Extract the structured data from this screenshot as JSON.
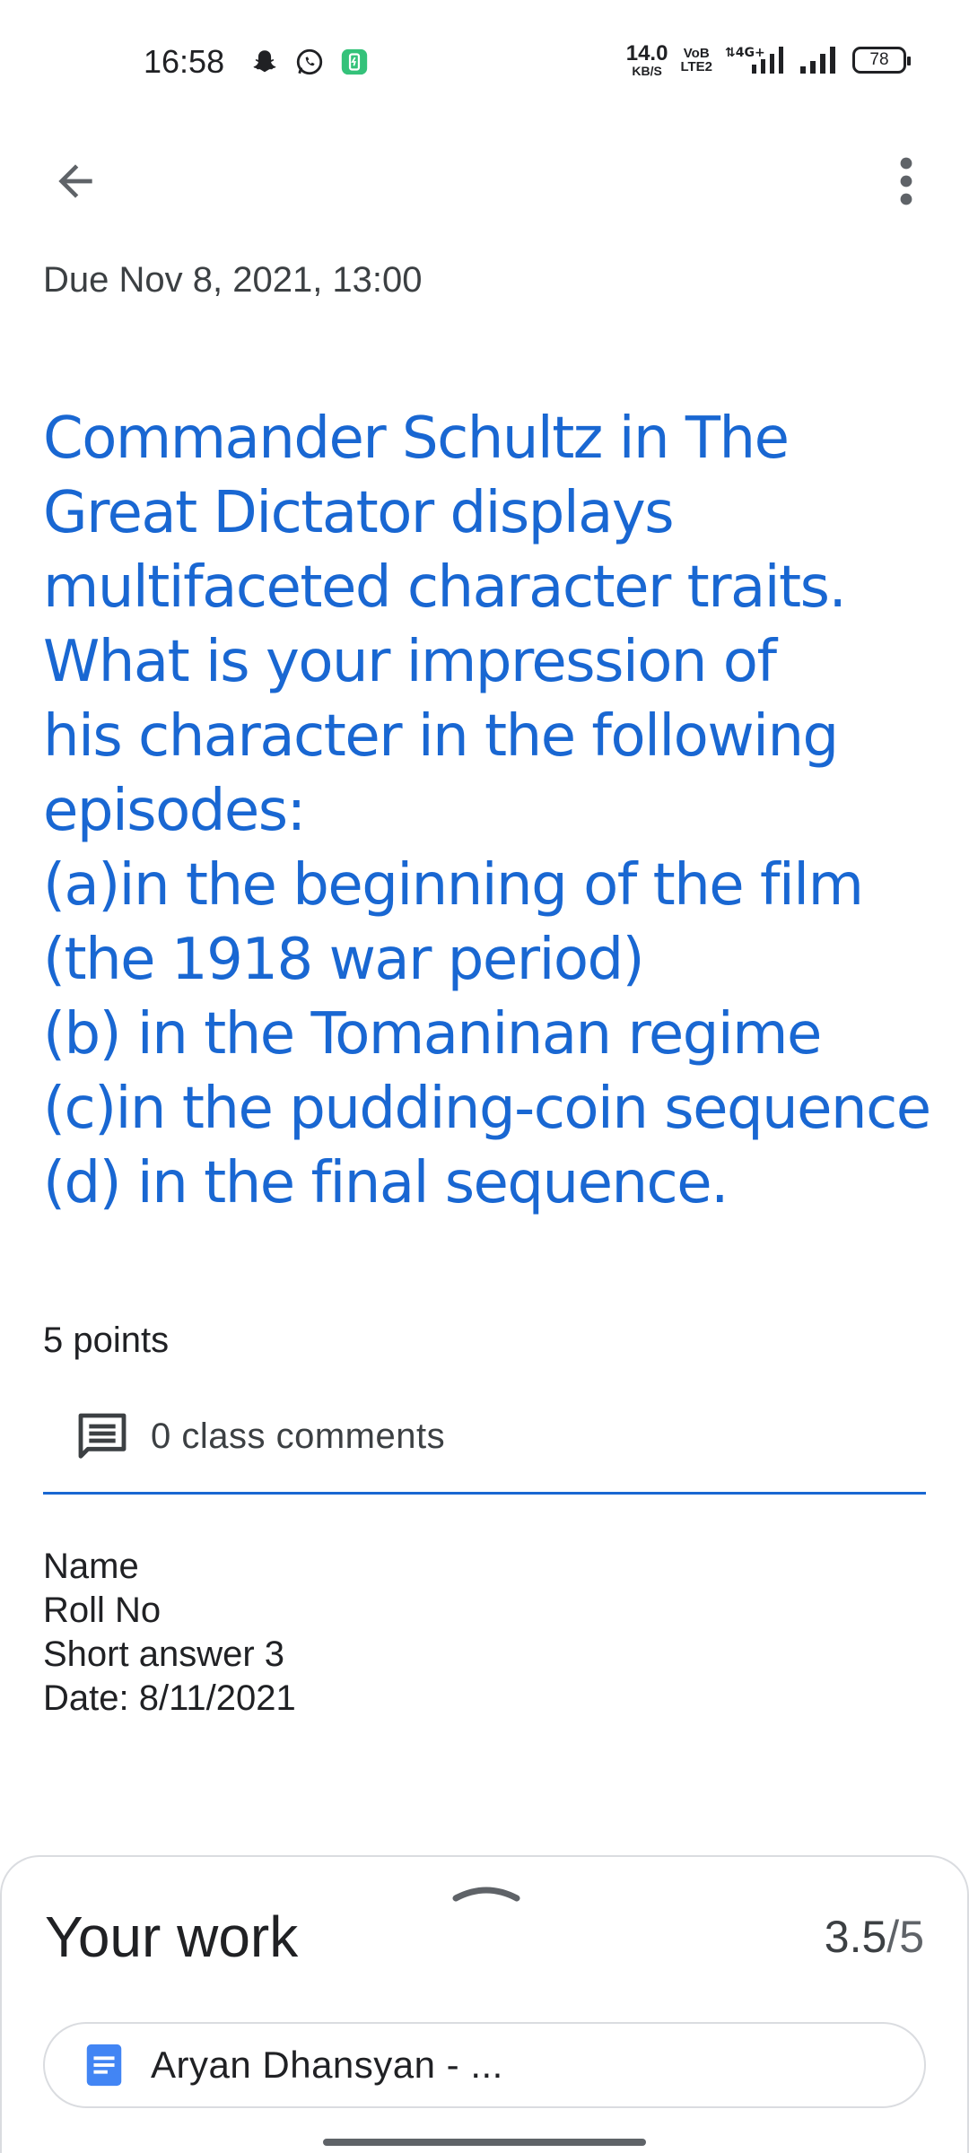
{
  "status_bar": {
    "time": "16:58",
    "net_speed": "14.0",
    "net_unit": "KB/S",
    "volte_top": "VoB",
    "volte_bottom": "LTE2",
    "network": "4G+",
    "battery": "78"
  },
  "icons": {
    "back": "arrow-left-icon",
    "more": "more-vert-icon",
    "comments": "comment-icon",
    "doc": "google-docs-icon",
    "expand": "chevron-up-icon"
  },
  "assignment": {
    "due": "Due Nov 8, 2021, 13:00",
    "question_lines": [
      "Commander Schultz in The",
      "Great Dictator displays",
      "multifaceted character traits.",
      "What is your impression of",
      "his character in the following",
      "episodes:",
      "(a)in the beginning of the film",
      "(the 1918 war period)",
      "(b) in the Tomaninan regime",
      "(c)in the pudding-coin sequence",
      "(d) in the final sequence."
    ],
    "points": "5 points",
    "comments_label": "0 class comments",
    "description_lines": [
      "Name",
      "Roll No",
      "Short answer 3",
      "Date: 8/11/2021"
    ]
  },
  "your_work": {
    "title": "Your work",
    "grade_num": "3.5",
    "grade_den": "/5",
    "attachment_label": "Aryan Dhansyan - ..."
  },
  "colors": {
    "accent": "#1967d2",
    "docs_blue": "#4285f4"
  }
}
